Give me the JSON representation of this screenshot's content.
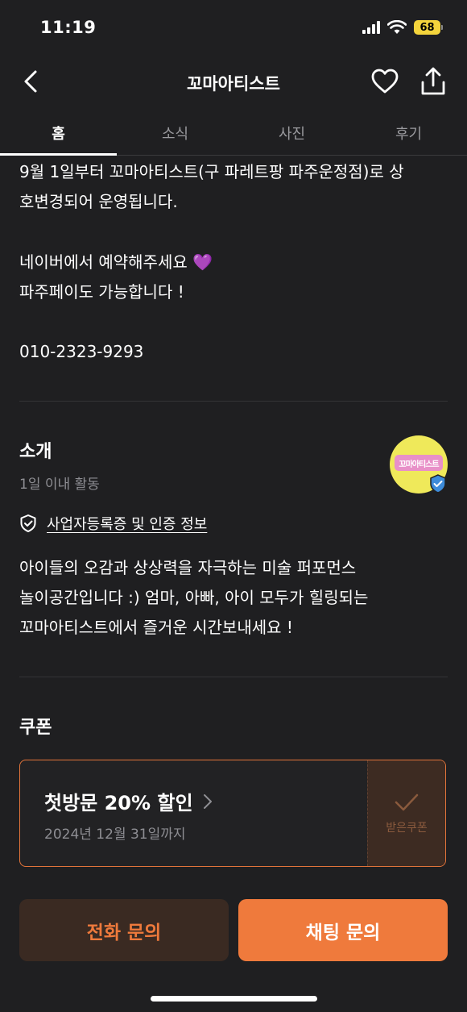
{
  "status": {
    "time": "11:19",
    "battery": "68"
  },
  "nav": {
    "title": "꼬마아티스트",
    "back_icon": "chevron-left-icon",
    "heart_icon": "heart-icon",
    "share_icon": "share-icon"
  },
  "tabs": [
    {
      "label": "홈",
      "active": true
    },
    {
      "label": "소식",
      "active": false
    },
    {
      "label": "사진",
      "active": false
    },
    {
      "label": "후기",
      "active": false
    }
  ],
  "notice": {
    "line1": "9월 1일부터 꼬마아티스트(구 파레트팡 파주운정점)로 상",
    "line2": "호변경되어 운영됩니다.",
    "line3": "네이버에서 예약해주세요 💜",
    "line4": "파주페이도 가능합니다 !",
    "phone": "010-2323-9293"
  },
  "intro": {
    "title": "소개",
    "activity": "1일 이내 활동",
    "avatar_logo": "꼬마아티스트",
    "cert_link": "사업자등록증 및 인증 정보",
    "desc_line1": "아이들의 오감과 상상력을 자극하는 미술 퍼포먼스",
    "desc_line2": "놀이공간입니다 :) 엄마, 아빠, 아이 모두가 힐링되는",
    "desc_line3": "꼬마아티스트에서 즐거운 시간보내세요 !"
  },
  "coupon": {
    "section_title": "쿠폰",
    "title": "첫방문 20% 할인",
    "valid_until": "2024년 12월 31일까지",
    "received_label": "받은쿠폰"
  },
  "actions": {
    "call": "전화 문의",
    "chat": "채팅 문의"
  },
  "colors": {
    "accent": "#ef7a3c",
    "background": "#1f1f21",
    "verified": "#3d8bd9"
  }
}
